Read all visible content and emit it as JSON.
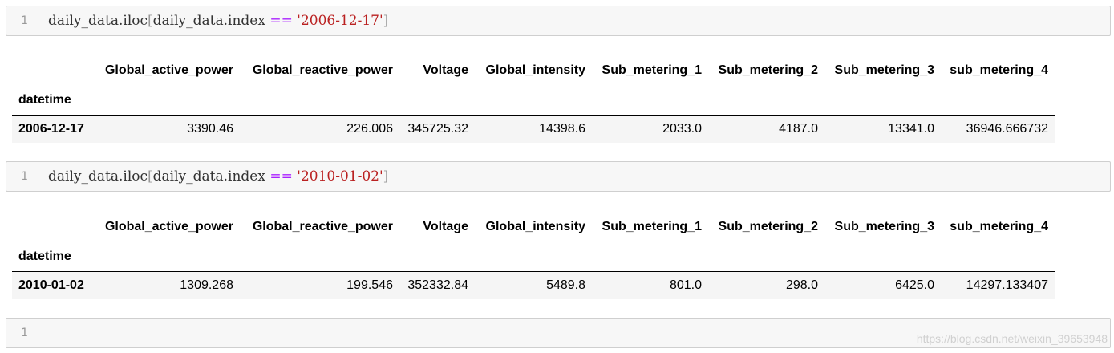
{
  "cells": [
    {
      "line_no": "1",
      "code": {
        "part1": "daily_data.iloc",
        "open_bracket": "[",
        "part2": "daily_data.index ",
        "op": "==",
        "space": " ",
        "string": "'2006-12-17'",
        "close_bracket": "]"
      }
    },
    {
      "line_no": "1",
      "code": {
        "part1": "daily_data.iloc",
        "open_bracket": "[",
        "part2": "daily_data.index ",
        "op": "==",
        "space": " ",
        "string": "'2010-01-02'",
        "close_bracket": "]"
      }
    },
    {
      "line_no": "1"
    }
  ],
  "outputs": [
    {
      "columns": [
        "Global_active_power",
        "Global_reactive_power",
        "Voltage",
        "Global_intensity",
        "Sub_metering_1",
        "Sub_metering_2",
        "Sub_metering_3",
        "sub_metering_4"
      ],
      "index_name": "datetime",
      "row": {
        "index": "2006-12-17",
        "values": [
          "3390.46",
          "226.006",
          "345725.32",
          "14398.6",
          "2033.0",
          "4187.0",
          "13341.0",
          "36946.666732"
        ]
      }
    },
    {
      "columns": [
        "Global_active_power",
        "Global_reactive_power",
        "Voltage",
        "Global_intensity",
        "Sub_metering_1",
        "Sub_metering_2",
        "Sub_metering_3",
        "sub_metering_4"
      ],
      "index_name": "datetime",
      "row": {
        "index": "2010-01-02",
        "values": [
          "1309.268",
          "199.546",
          "352332.84",
          "5489.8",
          "801.0",
          "298.0",
          "6425.0",
          "14297.133407"
        ]
      }
    }
  ],
  "watermark": "https://blog.csdn.net/weixin_39653948"
}
